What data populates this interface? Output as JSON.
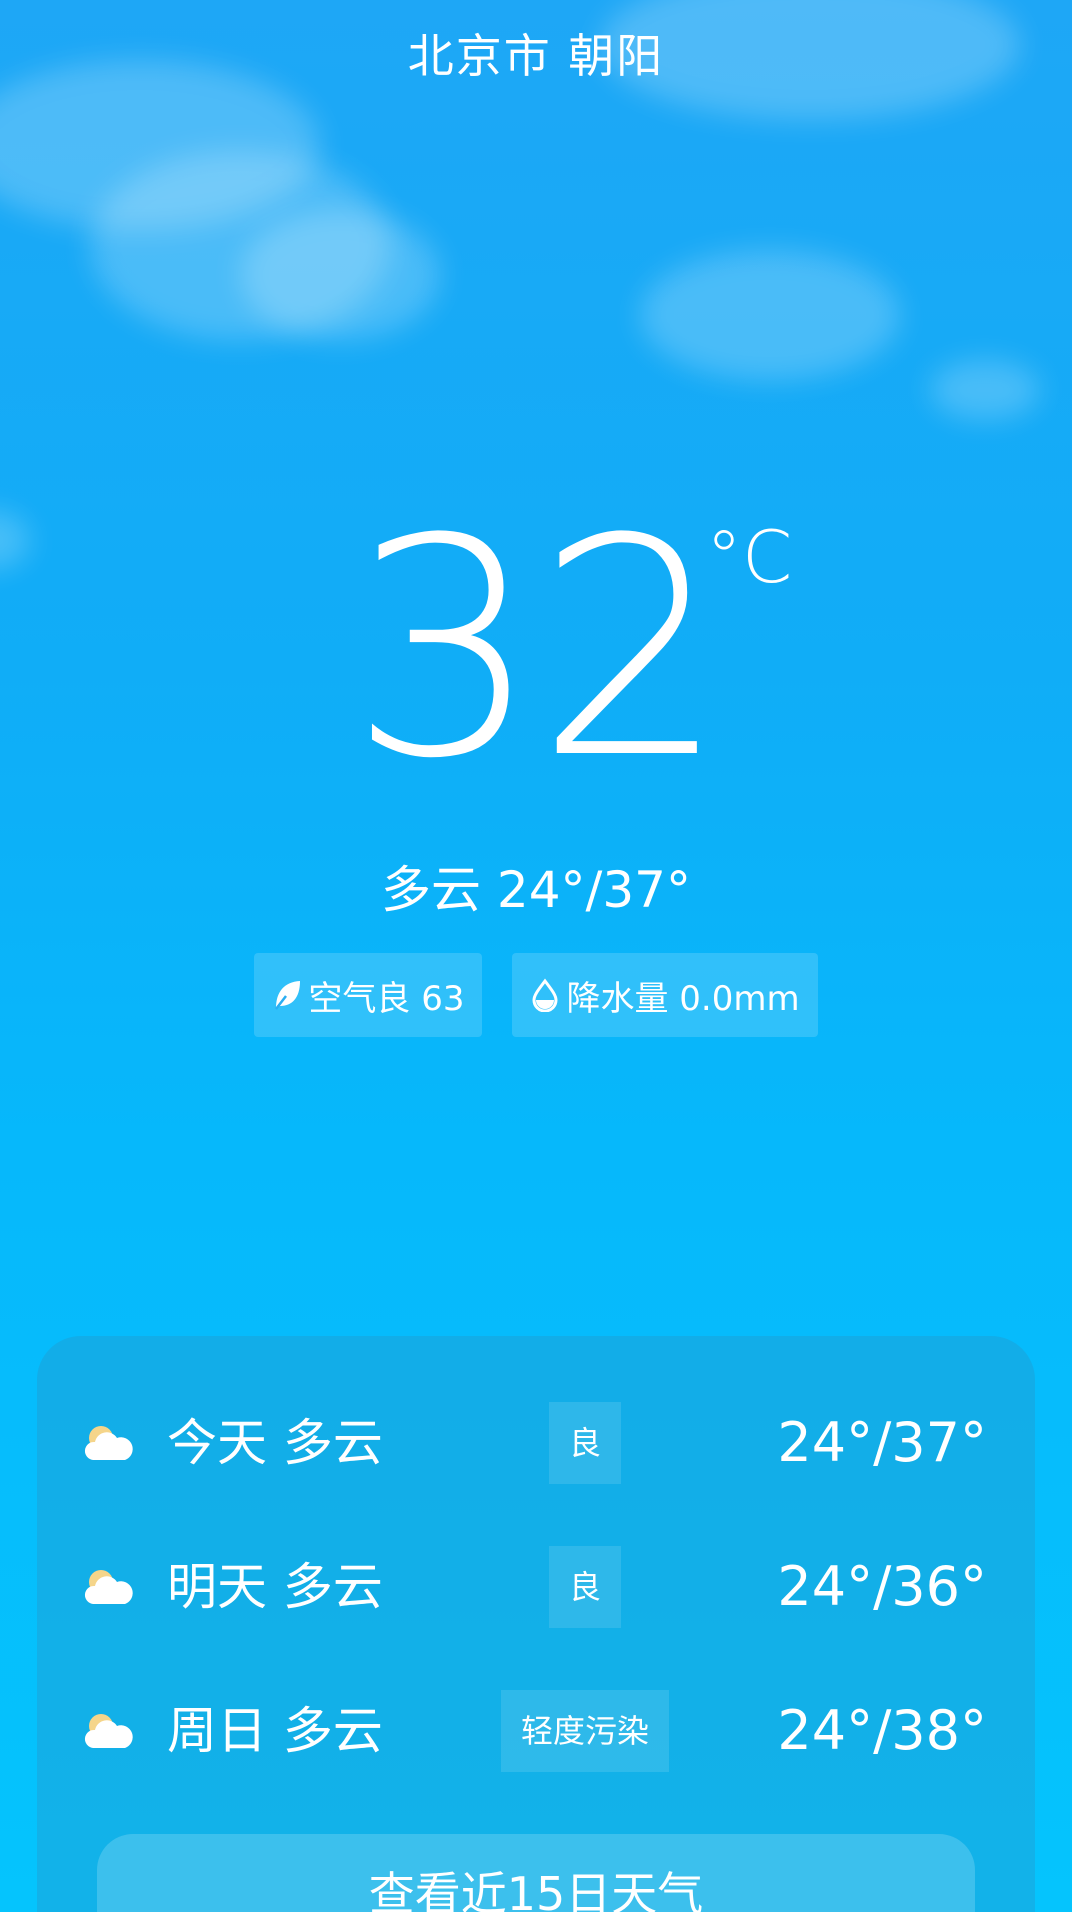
{
  "location": "北京市 朝阳",
  "current": {
    "temperature": "32",
    "unit": "°C",
    "condition_range": "多云 24°/37°"
  },
  "chips": [
    {
      "icon": "leaf-icon",
      "label": "空气良 63"
    },
    {
      "icon": "raindrop-icon",
      "label": "降水量 0.0mm"
    }
  ],
  "forecast": [
    {
      "icon": "partly-cloudy-icon",
      "day": "今天 多云",
      "aqi": "良",
      "range": "24°/37°"
    },
    {
      "icon": "partly-cloudy-icon",
      "day": "明天 多云",
      "aqi": "良",
      "range": "24°/36°"
    },
    {
      "icon": "partly-cloudy-icon",
      "day": "周日 多云",
      "aqi": "轻度污染",
      "range": "24°/38°"
    }
  ],
  "more_button": "查看近15日天气",
  "colors": {
    "sky_top": "#1ea7f6",
    "sky_bottom": "#05c4fd"
  }
}
